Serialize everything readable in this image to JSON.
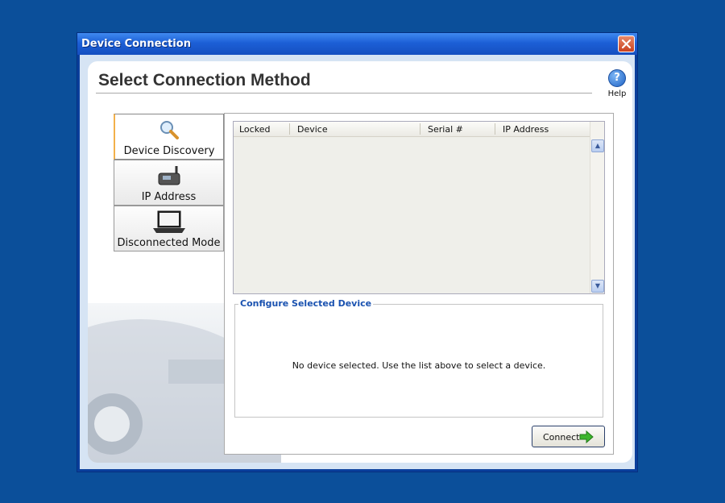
{
  "window": {
    "title": "Device Connection"
  },
  "header": {
    "title": "Select Connection Method",
    "help_label": "Help",
    "help_icon": "question-icon"
  },
  "tabs": [
    {
      "label": "Device Discovery",
      "icon": "magnifier-icon",
      "selected": true
    },
    {
      "label": "IP Address",
      "icon": "wireless-device-icon",
      "selected": false
    },
    {
      "label": "Disconnected Mode",
      "icon": "laptop-icon",
      "selected": false
    }
  ],
  "device_list": {
    "columns": [
      "Locked",
      "Device",
      "Serial #",
      "IP Address"
    ],
    "rows": []
  },
  "configure": {
    "legend": "Configure Selected Device",
    "message": "No device selected.  Use the list above to select a device."
  },
  "actions": {
    "connect_label": "Connect"
  },
  "colors": {
    "accent": "#1a52b0",
    "desktop": "#0b4f9a",
    "connect_arrow": "#3cb52c"
  }
}
